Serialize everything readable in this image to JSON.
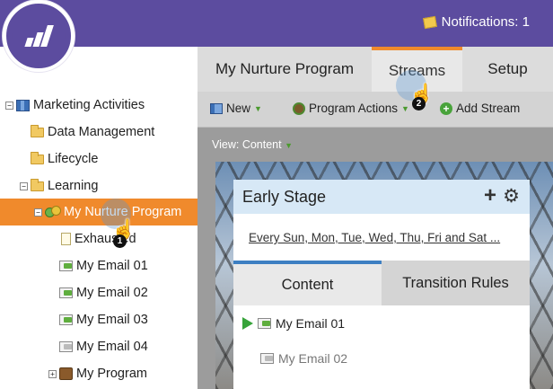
{
  "header": {
    "notifications_label": "Notifications: 1"
  },
  "logo": {
    "icon": "marketo-logo"
  },
  "tree": {
    "items": [
      {
        "label": "Marketing Activities",
        "icon": "activities-icon"
      },
      {
        "label": "Data Management",
        "icon": "folder-icon"
      },
      {
        "label": "Lifecycle",
        "icon": "folder-icon"
      },
      {
        "label": "Learning",
        "icon": "folder-icon"
      },
      {
        "label": "My Nurture Program",
        "icon": "program-icon",
        "selected": true
      },
      {
        "label": "Exhausted",
        "icon": "document-icon"
      },
      {
        "label": "My Email 01",
        "icon": "email-icon"
      },
      {
        "label": "My Email 02",
        "icon": "email-icon"
      },
      {
        "label": "My Email 03",
        "icon": "email-icon"
      },
      {
        "label": "My Email 04",
        "icon": "email-icon"
      },
      {
        "label": "My Program",
        "icon": "program-box-icon"
      }
    ]
  },
  "tabs": [
    {
      "label": "My Nurture Program"
    },
    {
      "label": "Streams",
      "active": true
    },
    {
      "label": "Setup"
    }
  ],
  "toolbar": {
    "new_label": "New",
    "program_actions_label": "Program Actions",
    "add_stream_label": "Add Stream"
  },
  "view": {
    "prefix": "View:",
    "value": "Content"
  },
  "stream": {
    "title": "Early Stage",
    "cadence": "Every Sun, Mon, Tue, Wed, Thu, Fri and Sat ...",
    "tabs": [
      {
        "label": "Content",
        "active": true
      },
      {
        "label": "Transition Rules"
      }
    ],
    "emails": [
      {
        "label": "My Email 01",
        "active": true
      },
      {
        "label": "My Email 02",
        "active": false
      }
    ]
  },
  "callouts": [
    {
      "number": "1"
    },
    {
      "number": "2"
    }
  ],
  "colors": {
    "header": "#5c4c9f",
    "selection": "#f08a2c",
    "active_tab_accent": "#3d7fc2"
  }
}
